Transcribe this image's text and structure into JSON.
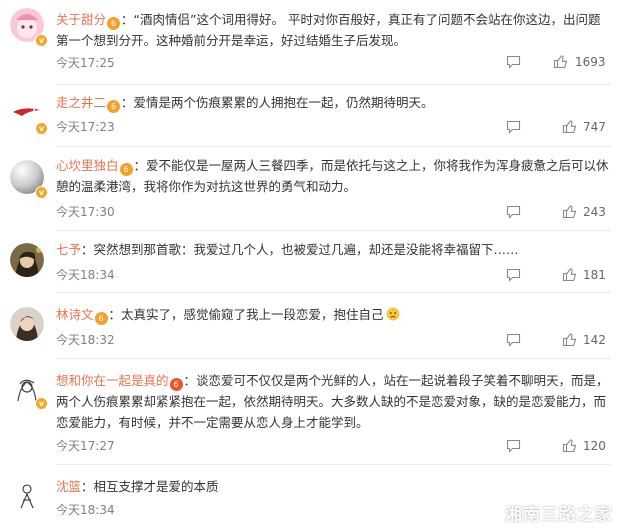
{
  "comments": [
    {
      "username": "关于甜分",
      "text": "“酒肉情侣”这个词用得好。 平时对你百般好，真正有了问题不会站在你这边，出问题第一个想到分开。这种婚前分开是幸运，好过结婚生子后发现。",
      "time": "今天17:25",
      "likes": "1693",
      "avatar": "pink-character-avatar"
    },
    {
      "username": "走之井二",
      "text": "爱情是两个伤痕累累的人拥抱在一起，仍然期待明天。",
      "time": "今天17:23",
      "likes": "747",
      "avatar": "red-bird-avatar"
    },
    {
      "username": "心坎里独白",
      "text": "爱不能仅是一屋两人三餐四季，而是依托与这之上，你将我作为浑身疲惫之后可以休憩的温柔港湾，我将你作为对抗这世界的勇气和动力。",
      "time": "今天17:30",
      "likes": "243",
      "avatar": "pearl-avatar"
    },
    {
      "username": "七予",
      "text": "突然想到那首歌：我爱过几个人，也被爱过几遍，却还是没能将幸福留下……",
      "time": "今天18:34",
      "likes": "181",
      "avatar": "girl-portrait-avatar"
    },
    {
      "username": "林诗文",
      "text": "太真实了，感觉偷窥了我上一段恋爱，抱住自己",
      "time": "今天18:32",
      "likes": "142",
      "avatar": "woman-portrait-avatar"
    },
    {
      "username": "想和你在一起是真的",
      "text": "谈恋爱可不仅仅是两个光鲜的人，站在一起说着段子笑着不聊明天，而是，两个人伤痕累累却紧紧抱在一起，依然期待明天。大多数人缺的不是恋爱对象，缺的是恋爱能力，而恋爱能力，有时候，并不一定需要从恋人身上才能学到。",
      "time": "今天17:27",
      "likes": "120",
      "avatar": "sketch-girl-avatar"
    },
    {
      "username": "沈篮",
      "text": "相互支撑才是爱的本质",
      "time": "今天18:34",
      "likes": "",
      "avatar": "sketch-figure-avatar"
    }
  ],
  "colors": {
    "username": "#eb7350",
    "text": "#333333",
    "meta": "#808080",
    "badge": "#f5a623"
  },
  "watermark": {
    "text": "湘南三路之家",
    "icon": "wechat-icon"
  }
}
